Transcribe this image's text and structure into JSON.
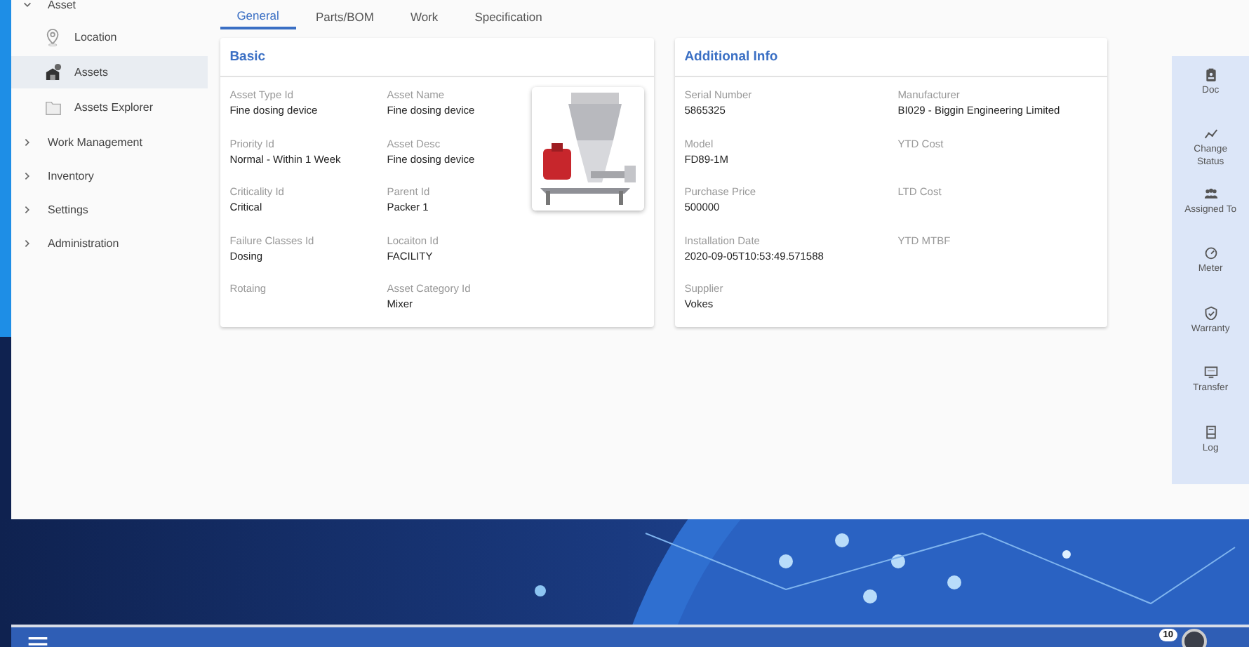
{
  "sidebar": {
    "items": [
      {
        "label": "Asset",
        "expanded": true,
        "children": [
          {
            "label": "Location",
            "selected": false
          },
          {
            "label": "Assets",
            "selected": true
          },
          {
            "label": "Assets Explorer",
            "selected": false
          }
        ]
      },
      {
        "label": "Work Management",
        "expanded": false
      },
      {
        "label": "Inventory",
        "expanded": false
      },
      {
        "label": "Settings",
        "expanded": false
      },
      {
        "label": "Administration",
        "expanded": false
      }
    ]
  },
  "tabs": [
    {
      "label": "General",
      "selected": true
    },
    {
      "label": "Parts/BOM",
      "selected": false
    },
    {
      "label": "Work",
      "selected": false
    },
    {
      "label": "Specification",
      "selected": false
    }
  ],
  "cards": [
    {
      "title": "Basic",
      "fields": [
        {
          "label": "Asset Type Id",
          "value": "Fine dosing device"
        },
        {
          "label": "Asset Name",
          "value": "Fine dosing device"
        },
        {
          "label": "Priority Id",
          "value": "Normal - Within 1 Week"
        },
        {
          "label": "Asset Desc",
          "value": "Fine dosing device"
        },
        {
          "label": "Criticality Id",
          "value": "Critical"
        },
        {
          "label": "Parent Id",
          "value": "Packer 1"
        },
        {
          "label": "Failure Classes Id",
          "value": "Dosing"
        },
        {
          "label": "Locaiton Id",
          "value": "FACILITY"
        },
        {
          "label": "Rotaing"
        },
        {
          "label": "Asset Category Id",
          "value": "Mixer"
        }
      ]
    },
    {
      "title": "Additional Info",
      "fields": [
        {
          "label": "Serial Number",
          "value": "5865325"
        },
        {
          "label": "Manufacturer",
          "value": "BI029 - Biggin Engineering Limited"
        },
        {
          "label": "Model",
          "value": "FD89-1M"
        },
        {
          "label": "YTD Cost"
        },
        {
          "label": "Purchase Price",
          "value": "500000"
        },
        {
          "label": "LTD Cost"
        },
        {
          "label": "Installation Date",
          "value": "2020-09-05T10:53:49.571588"
        },
        {
          "label": "YTD MTBF"
        },
        {
          "label": "Supplier",
          "value": "Vokes"
        }
      ]
    }
  ],
  "actions": [
    {
      "label": "Doc"
    },
    {
      "label": "Change Status"
    },
    {
      "label": "Assigned To"
    },
    {
      "label": "Meter"
    },
    {
      "label": "Warranty"
    },
    {
      "label": "Transfer"
    },
    {
      "label": "Log"
    }
  ],
  "bottom_bar": {
    "notification_count": "10"
  }
}
